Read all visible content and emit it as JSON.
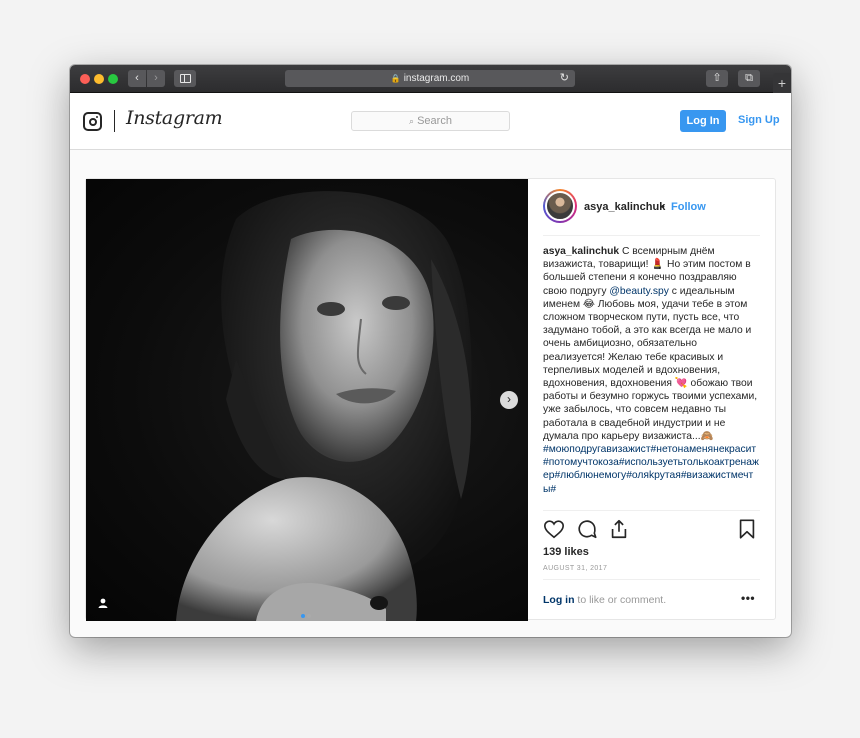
{
  "browser": {
    "url": "instagram.com",
    "back_glyph": "‹",
    "forward_glyph": "›",
    "reload_glyph": "↻",
    "share_glyph": "⇧",
    "tabs_glyph": "⧉",
    "newtab_glyph": "+",
    "lock_glyph": "🔒"
  },
  "header": {
    "wordmark": "Instagram",
    "search_placeholder": "Search",
    "search_icon_glyph": "⌕",
    "login_label": "Log In",
    "signup_label": "Sign Up"
  },
  "post": {
    "username": "asya_kalinchuk",
    "separator": "•",
    "follow_label": "Follow",
    "caption_user": "asya_kalinchuk",
    "caption_part1": " С всемирным днём визажиста, товарищи! 💄 Но этим постом в большей степени я конечно поздравляю свою подругу ",
    "caption_mention": "@beauty.spy",
    "caption_part2": " с идеальным именем 😂 Любовь моя, удачи тебе в этом сложном творческом пути, пусть все, что задумано тобой, а это как всегда не мало и очень амбициозно, обязательно реализуется! Желаю тебе красивых и терпеливых моделей и вдохновения, вдохновения, вдохновения 💘 обожаю твои работы и безумно горжусь твоими успехами, уже забылось, что совсем недавно ты работала в свадебной индустрии и не думала про карьеру визажиста...🙈 ",
    "caption_hashtags": "#моюподругавизажист#нетонаменянекрасит#потомучтокоза#используетьтолькоактренажер#люблюнемогу#оляkрутая#визажистмечты#",
    "likes": "139 likes",
    "date": "AUGUST 31, 2017",
    "login_link": "Log in",
    "login_suffix": " to like or comment.",
    "more_glyph": "•••",
    "next_glyph": "›",
    "user_tag_glyph": "👤"
  },
  "colors": {
    "accent": "#3897f0",
    "link": "#003569",
    "text": "#262626",
    "muted": "#999999"
  }
}
